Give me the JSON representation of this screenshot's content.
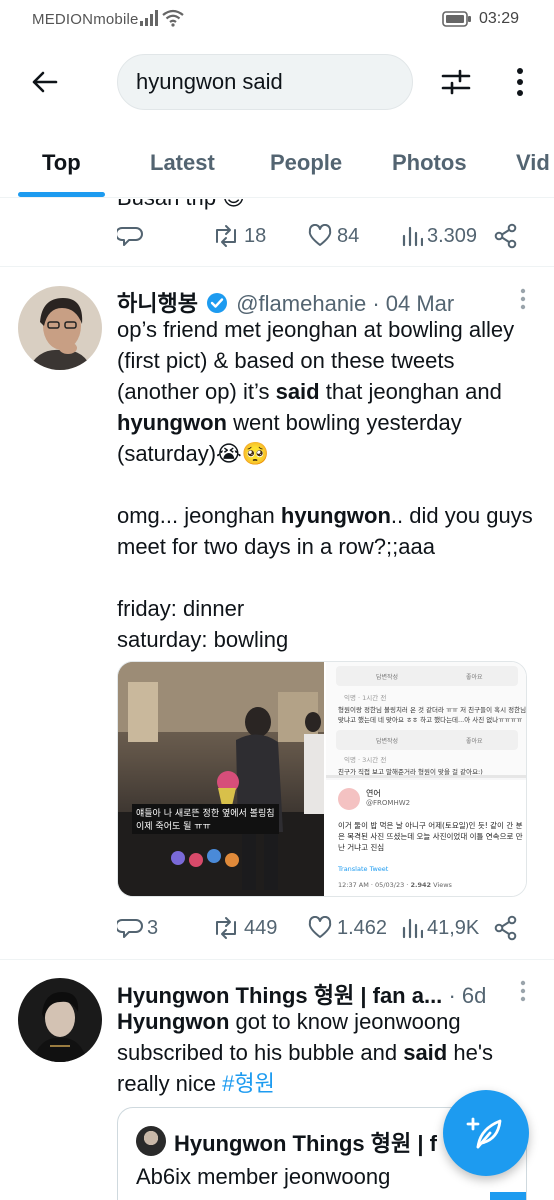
{
  "status_bar": {
    "carrier": "MEDIONmobile",
    "time": "03:29"
  },
  "search": {
    "query": "hyungwon said"
  },
  "tabs": [
    {
      "label": "Top",
      "active": true
    },
    {
      "label": "Latest",
      "active": false
    },
    {
      "label": "People",
      "active": false
    },
    {
      "label": "Photos",
      "active": false
    },
    {
      "label": "Vid",
      "active": false
    }
  ],
  "previous_tweet": {
    "partial_text": "Busan trip 😉",
    "retweets": "18",
    "likes": "84",
    "views": "3.309"
  },
  "tweet1": {
    "author_name": "하니행봉",
    "verified": true,
    "handle": "@flamehanie",
    "separator": "·",
    "date": "04 Mar",
    "text_parts": {
      "p1a": "op’s friend met jeonghan at bowling alley (first pict) & based on these tweets (another op) it’s ",
      "p1b": "said",
      "p1c": " that jeonghan and ",
      "p1d": "hyungwon",
      "p1e": " went bowling yesterday (saturday)😭🥺",
      "p2a": "omg... jeonghan ",
      "p2b": "hyungwon",
      "p2c": ".. did you guys meet for two days in a row?;;aaa",
      "p3": "friday: dinner",
      "p4": "saturday: bowling"
    },
    "media": {
      "caption_line1": "얘들아 나 새로뜬 정한 옆에서 볼링침",
      "caption_line2": "이제 죽어도 될 ㅠㅠ",
      "reply_button": "답변작성",
      "like_button": "좋아요",
      "comment1_meta": "익명 · 1시간 전",
      "comment1_line1": "형원이랑 정한님 볼링치러 온 것 같더라 ㅠㅠ 저 친구들이 혹시 정한님",
      "comment1_line2": "맞냐고 했는데 네 맞아요 ㅎㅎ 하고 했다는데...아 사진 없나ㅠㅠㅠㅠ",
      "comment2_meta": "익명 · 3시간 전",
      "comment2_line1": "친구가 직접 보고 말해준거라 형원이 맞을 걸 같아요:)",
      "embedded_name": "연어",
      "embedded_handle": "@FROMHW2",
      "embedded_text": "이거 둘이 밥 먹은 날 아니구 어제(토요일)인 듯! 같이 간 분은 목격된 사진 뜨셨는데 오늘 사진이었대 이틀 연속으로 만난 거냐고 진심",
      "translate": "Translate Tweet",
      "embedded_meta": "12:37 AM · 05/03/23 · ",
      "embedded_views_count": "2.942",
      "embedded_views_label": " Views"
    },
    "replies": "3",
    "retweets": "449",
    "likes": "1.462",
    "views": "41,9K"
  },
  "tweet2": {
    "author_name": "Hyungwon Things 형원 | fan a...",
    "separator": "·",
    "date": "6d",
    "text_parts": {
      "a": "Hyungwon",
      "b": " got to know jeonwoong subscribed to his bubble and ",
      "c": "said",
      "d": " he's really nice ",
      "hashtag": "#형원"
    },
    "quote": {
      "author_name": "Hyungwon Things 형원 | f",
      "text": "Ab6ix member jeonwoong"
    }
  },
  "colors": {
    "accent": "#1d9bf0",
    "text_primary": "#0f1419",
    "text_secondary": "#536471"
  },
  "icons": [
    "back-arrow-icon",
    "filter-icon",
    "more-vertical-icon",
    "reply-icon",
    "retweet-icon",
    "like-icon",
    "views-icon",
    "share-icon",
    "verified-badge-icon",
    "compose-icon"
  ]
}
